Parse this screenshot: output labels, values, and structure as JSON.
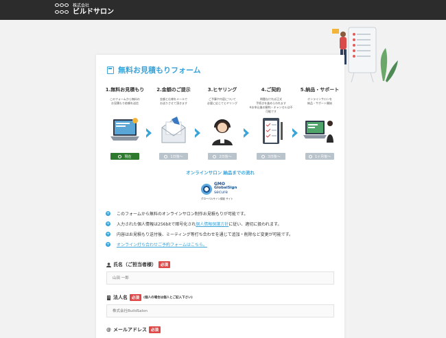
{
  "brand": {
    "small": "株式会社",
    "name": "ビルドサロン"
  },
  "form": {
    "title": "無料お見積もりフォーム",
    "flow_label": "オンラインサロン 納品までの流れ",
    "steps": [
      {
        "title": "1.無料お見積もり",
        "desc": "このフォームから無料の\nお見積もり依頼を送信",
        "badge": "現在"
      },
      {
        "title": "2.金額のご提示",
        "desc": "金額と仕様をメールで\nお送りさせて頂きます",
        "badge": "1日後〜"
      },
      {
        "title": "3.ヒヤリング",
        "desc": "ご予算や内容について\n必要に応じてヒヤリング",
        "badge": "2日後〜"
      },
      {
        "title": "4.ご契約",
        "desc": "問題なければ正式\n手続きを進めらわれます\n※お申込後の解約・キャンセルは不可能です",
        "badge": "3日後〜"
      },
      {
        "title": "5.納品・サポート",
        "desc": "オンラインサロンを\n納品・サポート開始",
        "badge": "1ヶ月後〜"
      }
    ],
    "security": {
      "brand": "GMO",
      "name": "GlobalSign",
      "sub": "secure",
      "caption": "グローバルサイン認証 サイト"
    },
    "notes": [
      {
        "text": "このフォームから無料のオンラインサロン制作お見積もりが可能です。"
      },
      {
        "pre": "入力された個人情報は256bitで暗号化され",
        "link": "個人情報保護方針",
        "post": "に従い、適切に扱われます。"
      },
      {
        "text": "内容はお見積もり送付後、ミーティング等打ち合わせを通じて追加・削除など変更が可能です。"
      },
      {
        "link": "オンライン打ち合わせご予約フォームはこちら。"
      }
    ],
    "fields": [
      {
        "label": "氏名（ご担当者様）",
        "required": "必須",
        "hint": "",
        "placeholder": "山田 一郎",
        "icon": "person-icon"
      },
      {
        "label": "法人名",
        "required": "必須",
        "hint": "(個人の場合は個人とご記入下さい)",
        "placeholder": "株式会社BuildSalon",
        "icon": "building-icon"
      },
      {
        "label": "メールアドレス",
        "required": "必須",
        "hint": "",
        "placeholder": "",
        "icon": "at-icon"
      }
    ]
  },
  "colors": {
    "accent": "#3aa3d8",
    "required": "#e04848",
    "current": "#2d7a2e",
    "badge": "#b9c3cc",
    "topbar": "#2c2c2c"
  }
}
